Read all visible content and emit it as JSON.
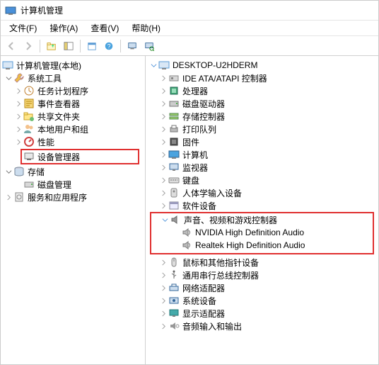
{
  "title": "计算机管理",
  "menus": [
    {
      "label": "文件(F)"
    },
    {
      "label": "操作(A)"
    },
    {
      "label": "查看(V)"
    },
    {
      "label": "帮助(H)"
    }
  ],
  "toolbar": [
    {
      "name": "back",
      "disabled": true
    },
    {
      "name": "forward",
      "disabled": true
    },
    {
      "name": "up"
    },
    {
      "name": "show-hide-tree"
    },
    {
      "name": "properties"
    },
    {
      "name": "help"
    },
    {
      "name": "refresh"
    },
    {
      "name": "scan"
    }
  ],
  "left_tree": {
    "root": "计算机管理(本地)",
    "groups": [
      {
        "label": "系统工具",
        "expanded": true,
        "children": [
          {
            "label": "任务计划程序",
            "icon": "clock"
          },
          {
            "label": "事件查看器",
            "icon": "event"
          },
          {
            "label": "共享文件夹",
            "icon": "share"
          },
          {
            "label": "本地用户和组",
            "icon": "users"
          },
          {
            "label": "性能",
            "icon": "perf"
          },
          {
            "label": "设备管理器",
            "icon": "device",
            "highlight": true
          }
        ]
      },
      {
        "label": "存储",
        "expanded": true,
        "children": [
          {
            "label": "磁盘管理",
            "icon": "disk"
          }
        ]
      },
      {
        "label": "服务和应用程序",
        "expanded": false,
        "children": []
      }
    ]
  },
  "right_tree": {
    "root": "DESKTOP-U2HDERM",
    "items": [
      {
        "label": "IDE ATA/ATAPI 控制器",
        "icon": "ide"
      },
      {
        "label": "处理器",
        "icon": "cpu"
      },
      {
        "label": "磁盘驱动器",
        "icon": "drive"
      },
      {
        "label": "存储控制器",
        "icon": "storage"
      },
      {
        "label": "打印队列",
        "icon": "printer"
      },
      {
        "label": "固件",
        "icon": "firmware"
      },
      {
        "label": "计算机",
        "icon": "computer"
      },
      {
        "label": "监视器",
        "icon": "monitor"
      },
      {
        "label": "键盘",
        "icon": "keyboard"
      },
      {
        "label": "人体学输入设备",
        "icon": "hid"
      },
      {
        "label": "软件设备",
        "icon": "software"
      },
      {
        "label": "声音、视频和游戏控制器",
        "icon": "sound",
        "expanded": true,
        "highlight": true,
        "children": [
          {
            "label": "NVIDIA High Definition Audio",
            "icon": "speaker"
          },
          {
            "label": "Realtek High Definition Audio",
            "icon": "speaker"
          }
        ]
      },
      {
        "label": "鼠标和其他指针设备",
        "icon": "mouse"
      },
      {
        "label": "通用串行总线控制器",
        "icon": "usb"
      },
      {
        "label": "网络适配器",
        "icon": "network"
      },
      {
        "label": "系统设备",
        "icon": "system"
      },
      {
        "label": "显示适配器",
        "icon": "display"
      },
      {
        "label": "音频输入和输出",
        "icon": "audio-io"
      }
    ]
  }
}
